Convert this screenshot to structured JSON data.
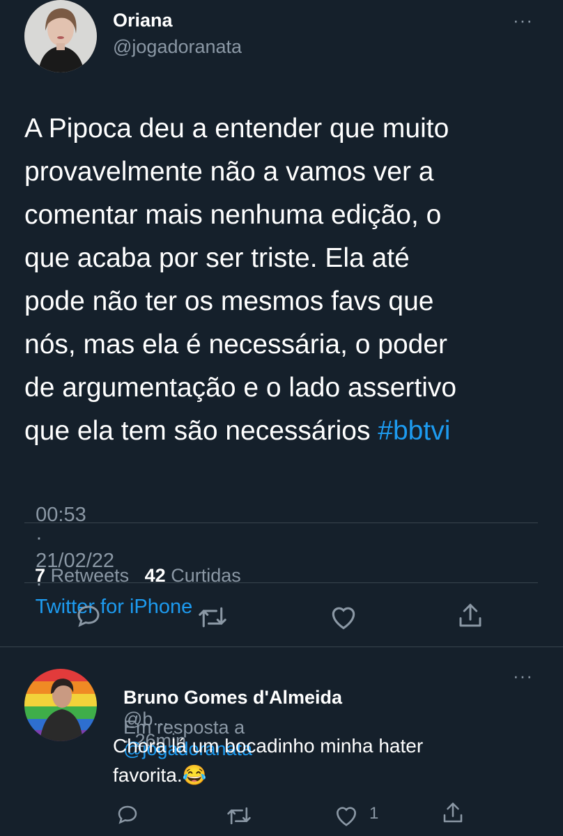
{
  "tweet": {
    "author_name": "Oriana",
    "author_handle": "@jogadoranata",
    "text_lines": [
      "A Pipoca deu a entender que muito",
      "provavelmente não a vamos ver a",
      "comentar mais nenhuma edição, o",
      "que acaba por ser triste. Ela até",
      "pode não ter os mesmos favs que",
      "nós, mas ela é necessária, o poder",
      "de argumentação e o lado assertivo",
      "que ela tem são necessários "
    ],
    "hashtag": "#bbtvi",
    "time": "00:53",
    "date": "21/02/22",
    "sep": "·",
    "source": "Twitter for iPhone",
    "retweet_count": "7",
    "retweet_label": "Retweets",
    "like_count": "42",
    "like_label": "Curtidas",
    "more_label": "···"
  },
  "reply": {
    "author_name": "Bruno Gomes d'Almeida",
    "author_handle": "@b...",
    "time": "· 26min",
    "more_label": "···",
    "in_reply_prefix": "Em resposta a",
    "in_reply_handle": "@jogadoranata",
    "text_line1": "Chora lá um bocadinho minha hater",
    "text_line2": "favorita.",
    "emoji": "😂",
    "like_count": "1"
  },
  "colors": {
    "background": "#15202b",
    "muted": "#8b98a5",
    "link": "#1d9bf0",
    "divider": "#38444d"
  },
  "icons": [
    "reply-icon",
    "retweet-icon",
    "like-icon",
    "share-icon",
    "more-icon"
  ]
}
